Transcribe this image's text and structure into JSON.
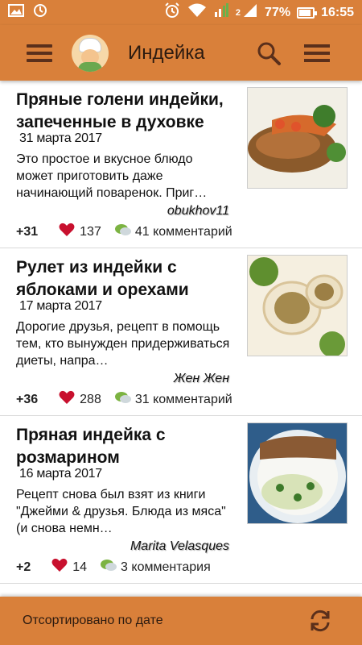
{
  "status_bar": {
    "battery": "77%",
    "time": "16:55",
    "sim_slot": "2",
    "icons": [
      "image-icon",
      "sync-icon",
      "alarm-icon",
      "wifi-icon",
      "signal-icon",
      "signal-icon",
      "battery-icon"
    ]
  },
  "app_bar": {
    "title": "Индейка",
    "menu_icon": "hamburger-icon",
    "logo": "chef-logo",
    "search_icon": "search-icon",
    "overflow_icon": "overflow-menu-icon"
  },
  "recipes": [
    {
      "title": "Пряные голени индейки, запеченные в духовке",
      "date": "31 марта 2017",
      "description": "Это простое и вкусное блюдо может приготовить даже начинающий поваренок. Приг…",
      "author": "obukhov11",
      "rating": "+31",
      "likes": "137",
      "comments": "41 комментарий",
      "thumb_colors": [
        "#5a3a1c",
        "#d66a2c",
        "#8b6f3c"
      ]
    },
    {
      "title": "Рулет из индейки с яблоками и орехами",
      "date": "17 марта 2017",
      "description": "Дорогие друзья, рецепт в помощь тем, кто вынужден придерживаться диеты, напра…",
      "author": "Жен Жен",
      "rating": "+36",
      "likes": "288",
      "comments": "31 комментарий",
      "thumb_colors": [
        "#e9dcc0",
        "#a0843f",
        "#7b9b3a"
      ]
    },
    {
      "title": "Пряная индейка с розмарином",
      "date": "16 марта 2017",
      "description": "Рецепт снова был взят из книги \"Джейми & друзья. Блюда из мяса\" (и снова немн…",
      "author": "Marita Velasques",
      "rating": "+2",
      "likes": "14",
      "comments": "3 комментария",
      "thumb_colors": [
        "#8a5a34",
        "#dfe8c8",
        "#2f6fa8"
      ]
    }
  ],
  "bottom_bar": {
    "sort_label": "Отсортировано по дате",
    "refresh_icon": "refresh-icon"
  },
  "colors": {
    "accent": "#d9803a",
    "heart": "#c8102e",
    "text": "#111111"
  }
}
